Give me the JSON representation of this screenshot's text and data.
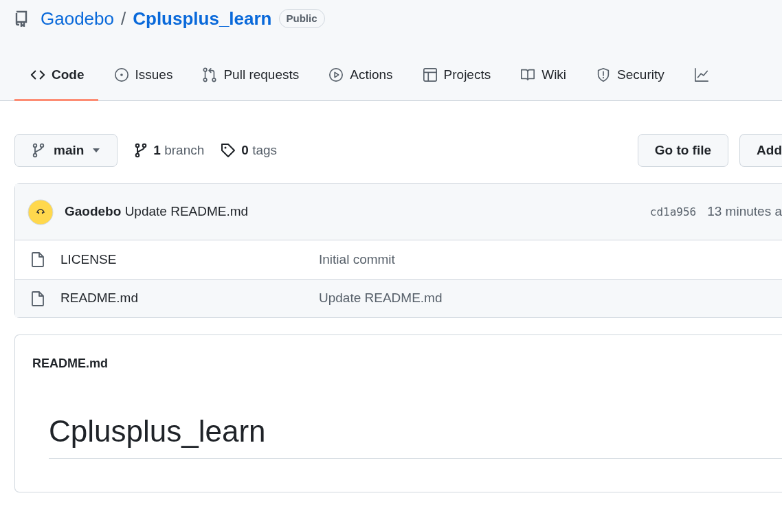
{
  "repo": {
    "owner": "Gaodebo",
    "separator": "/",
    "name": "Cplusplus_learn",
    "visibility": "Public"
  },
  "tabs": [
    {
      "label": "Code",
      "selected": true
    },
    {
      "label": "Issues",
      "selected": false
    },
    {
      "label": "Pull requests",
      "selected": false
    },
    {
      "label": "Actions",
      "selected": false
    },
    {
      "label": "Projects",
      "selected": false
    },
    {
      "label": "Wiki",
      "selected": false
    },
    {
      "label": "Security",
      "selected": false
    },
    {
      "selected": false
    }
  ],
  "toolbar": {
    "branch": "main",
    "branch_count": "1",
    "branch_label": "branch",
    "tag_count": "0",
    "tag_label": "tags",
    "buttons": [
      "Go to file",
      "Add"
    ]
  },
  "latest_commit": {
    "author": "Gaodebo",
    "message": "Update README.md",
    "sha": "cd1a956",
    "time": "13 minutes a"
  },
  "files": [
    {
      "name": "LICENSE",
      "commit": "Initial commit"
    },
    {
      "name": "README.md",
      "commit": "Update README.md"
    }
  ],
  "readme": {
    "filename": "README.md",
    "heading": "Cplusplus_learn"
  }
}
